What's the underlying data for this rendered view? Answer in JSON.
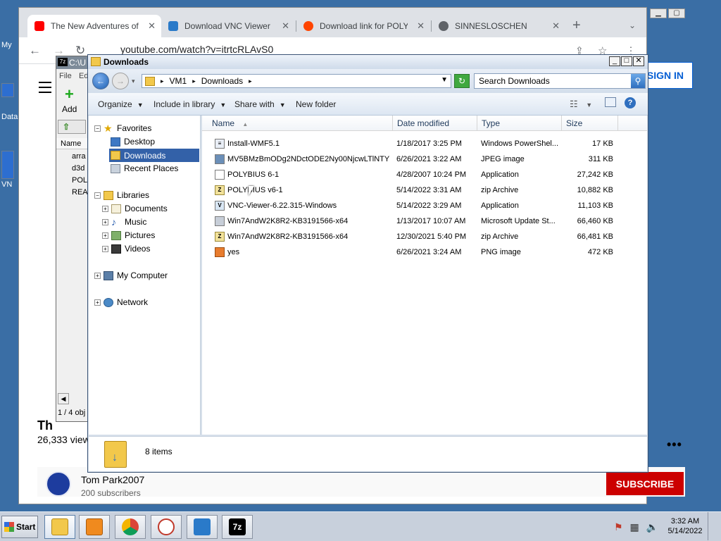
{
  "desktop": {
    "icons": [
      {
        "label": "My"
      },
      {
        "label": "Data"
      },
      {
        "label": "VN"
      }
    ]
  },
  "chrome": {
    "tabs": [
      {
        "title": "The New Adventures of",
        "favicon": "youtube-icon"
      },
      {
        "title": "Download VNC Viewer",
        "favicon": "vnc-icon"
      },
      {
        "title": "Download link for POLY",
        "favicon": "reddit-icon"
      },
      {
        "title": "SINNESLOSCHEN",
        "favicon": "globe-icon"
      }
    ],
    "url": "youtube.com/watch?v=itrtcRLAvS0",
    "sign_in": "SIGN IN",
    "video_title_partial": "Th",
    "views_partial": "26,333 view",
    "channel": {
      "name": "Tom Park2007",
      "subscribers": "200 subscribers"
    },
    "subscribe": "SUBSCRIBE"
  },
  "sevenzip": {
    "title": "C:\\U",
    "app_badge": "7z",
    "menu": [
      "File",
      "Ed"
    ],
    "add_label": "Add",
    "column_name": "Name",
    "items": [
      "arra",
      "d3d",
      "POL",
      "REA"
    ],
    "status": "1 / 4 obj"
  },
  "explorer": {
    "title": "Downloads",
    "breadcrumb": [
      "VM1",
      "Downloads"
    ],
    "search_placeholder": "Search Downloads",
    "commands": {
      "organize": "Organize",
      "include": "Include in library",
      "share": "Share with",
      "new_folder": "New folder"
    },
    "nav": {
      "favorites": "Favorites",
      "desktop": "Desktop",
      "downloads": "Downloads",
      "recent": "Recent Places",
      "libraries": "Libraries",
      "documents": "Documents",
      "music": "Music",
      "pictures": "Pictures",
      "videos": "Videos",
      "computer": "My Computer",
      "network": "Network"
    },
    "columns": {
      "name": "Name",
      "date": "Date modified",
      "type": "Type",
      "size": "Size"
    },
    "files": [
      {
        "name": "Install-WMF5.1",
        "date": "1/18/2017 3:25 PM",
        "type": "Windows PowerShel...",
        "size": "17 KB"
      },
      {
        "name": "MV5BMzBmODg2NDctODE2Ny00NjcwLTlNTYt...",
        "date": "6/26/2021 3:22 AM",
        "type": "JPEG image",
        "size": "311 KB"
      },
      {
        "name": "POLYBIUS 6-1",
        "date": "4/28/2007 10:24 PM",
        "type": "Application",
        "size": "27,242 KB"
      },
      {
        "name": "POLYBIUS v6-1",
        "date": "5/14/2022 3:31 AM",
        "type": "zip Archive",
        "size": "10,882 KB"
      },
      {
        "name": "VNC-Viewer-6.22.315-Windows",
        "date": "5/14/2022 3:29 AM",
        "type": "Application",
        "size": "11,103 KB"
      },
      {
        "name": "Win7AndW2K8R2-KB3191566-x64",
        "date": "1/13/2017 10:07 AM",
        "type": "Microsoft Update St...",
        "size": "66,460 KB"
      },
      {
        "name": "Win7AndW2K8R2-KB3191566-x64",
        "date": "12/30/2021 5:40 PM",
        "type": "zip Archive",
        "size": "66,481 KB"
      },
      {
        "name": "yes",
        "date": "6/26/2021 3:24 AM",
        "type": "PNG image",
        "size": "472 KB"
      }
    ],
    "item_count": "8 items"
  },
  "taskbar": {
    "start": "Start",
    "apps": [
      "explorer",
      "media-player",
      "chrome",
      "snipping-tool",
      "vnc-viewer",
      "7-zip"
    ],
    "time": "3:32 AM",
    "date": "5/14/2022"
  }
}
